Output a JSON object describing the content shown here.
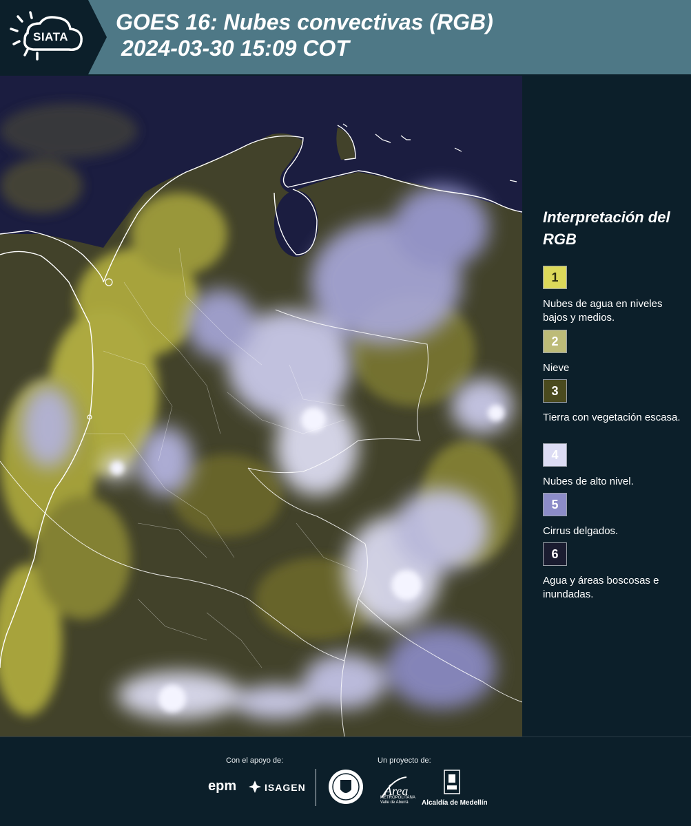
{
  "header": {
    "logo": "SIATA",
    "title_line1": "GOES 16: Nubes convectivas (RGB)",
    "title_line2": " 2024-03-30 15:09 COT",
    "background_color": "#4e7886",
    "logo_block_color": "#0c1f2a"
  },
  "map": {
    "ocean_color": "#1b1d40",
    "land_color": "#4a4a2a",
    "low_cloud_color": "#c8c44a",
    "high_cloud_color": "#d8d8f4",
    "border_color": "#ffffff"
  },
  "legend": {
    "title": "Interpretación del RGB",
    "items": [
      {
        "number": "1",
        "label": "Nubes de agua en niveles bajos y medios.",
        "color": "#dcd95a",
        "text_color": "#2a2a10"
      },
      {
        "number": "2",
        "label": "Nieve",
        "color": "#bdbb78",
        "text_color": "#ffffff"
      },
      {
        "number": "3",
        "label": "Tierra con vegetación escasa.",
        "color": "#4a4a1e",
        "text_color": "#ffffff"
      },
      {
        "number": "4",
        "label": "Nubes de alto nivel.",
        "color": "#dcdcf4",
        "text_color": "#ffffff"
      },
      {
        "number": "5",
        "label": "Cirrus delgados.",
        "color": "#8c8cc8",
        "text_color": "#ffffff"
      },
      {
        "number": "6",
        "label": "Agua y áreas boscosas e inundadas.",
        "color": "#1a1c30",
        "text_color": "#ffffff"
      }
    ]
  },
  "footer": {
    "support_caption": "Con el apoyo de:",
    "project_caption": "Un proyecto de:",
    "epm_logo": "epm",
    "isagen_logo": "ISAGEN",
    "area_logo": "Área",
    "area_subtitle": "METROPOLITANA\nValle de Aburrá",
    "alcaldia_logo": "Alcaldía de Medellín"
  }
}
